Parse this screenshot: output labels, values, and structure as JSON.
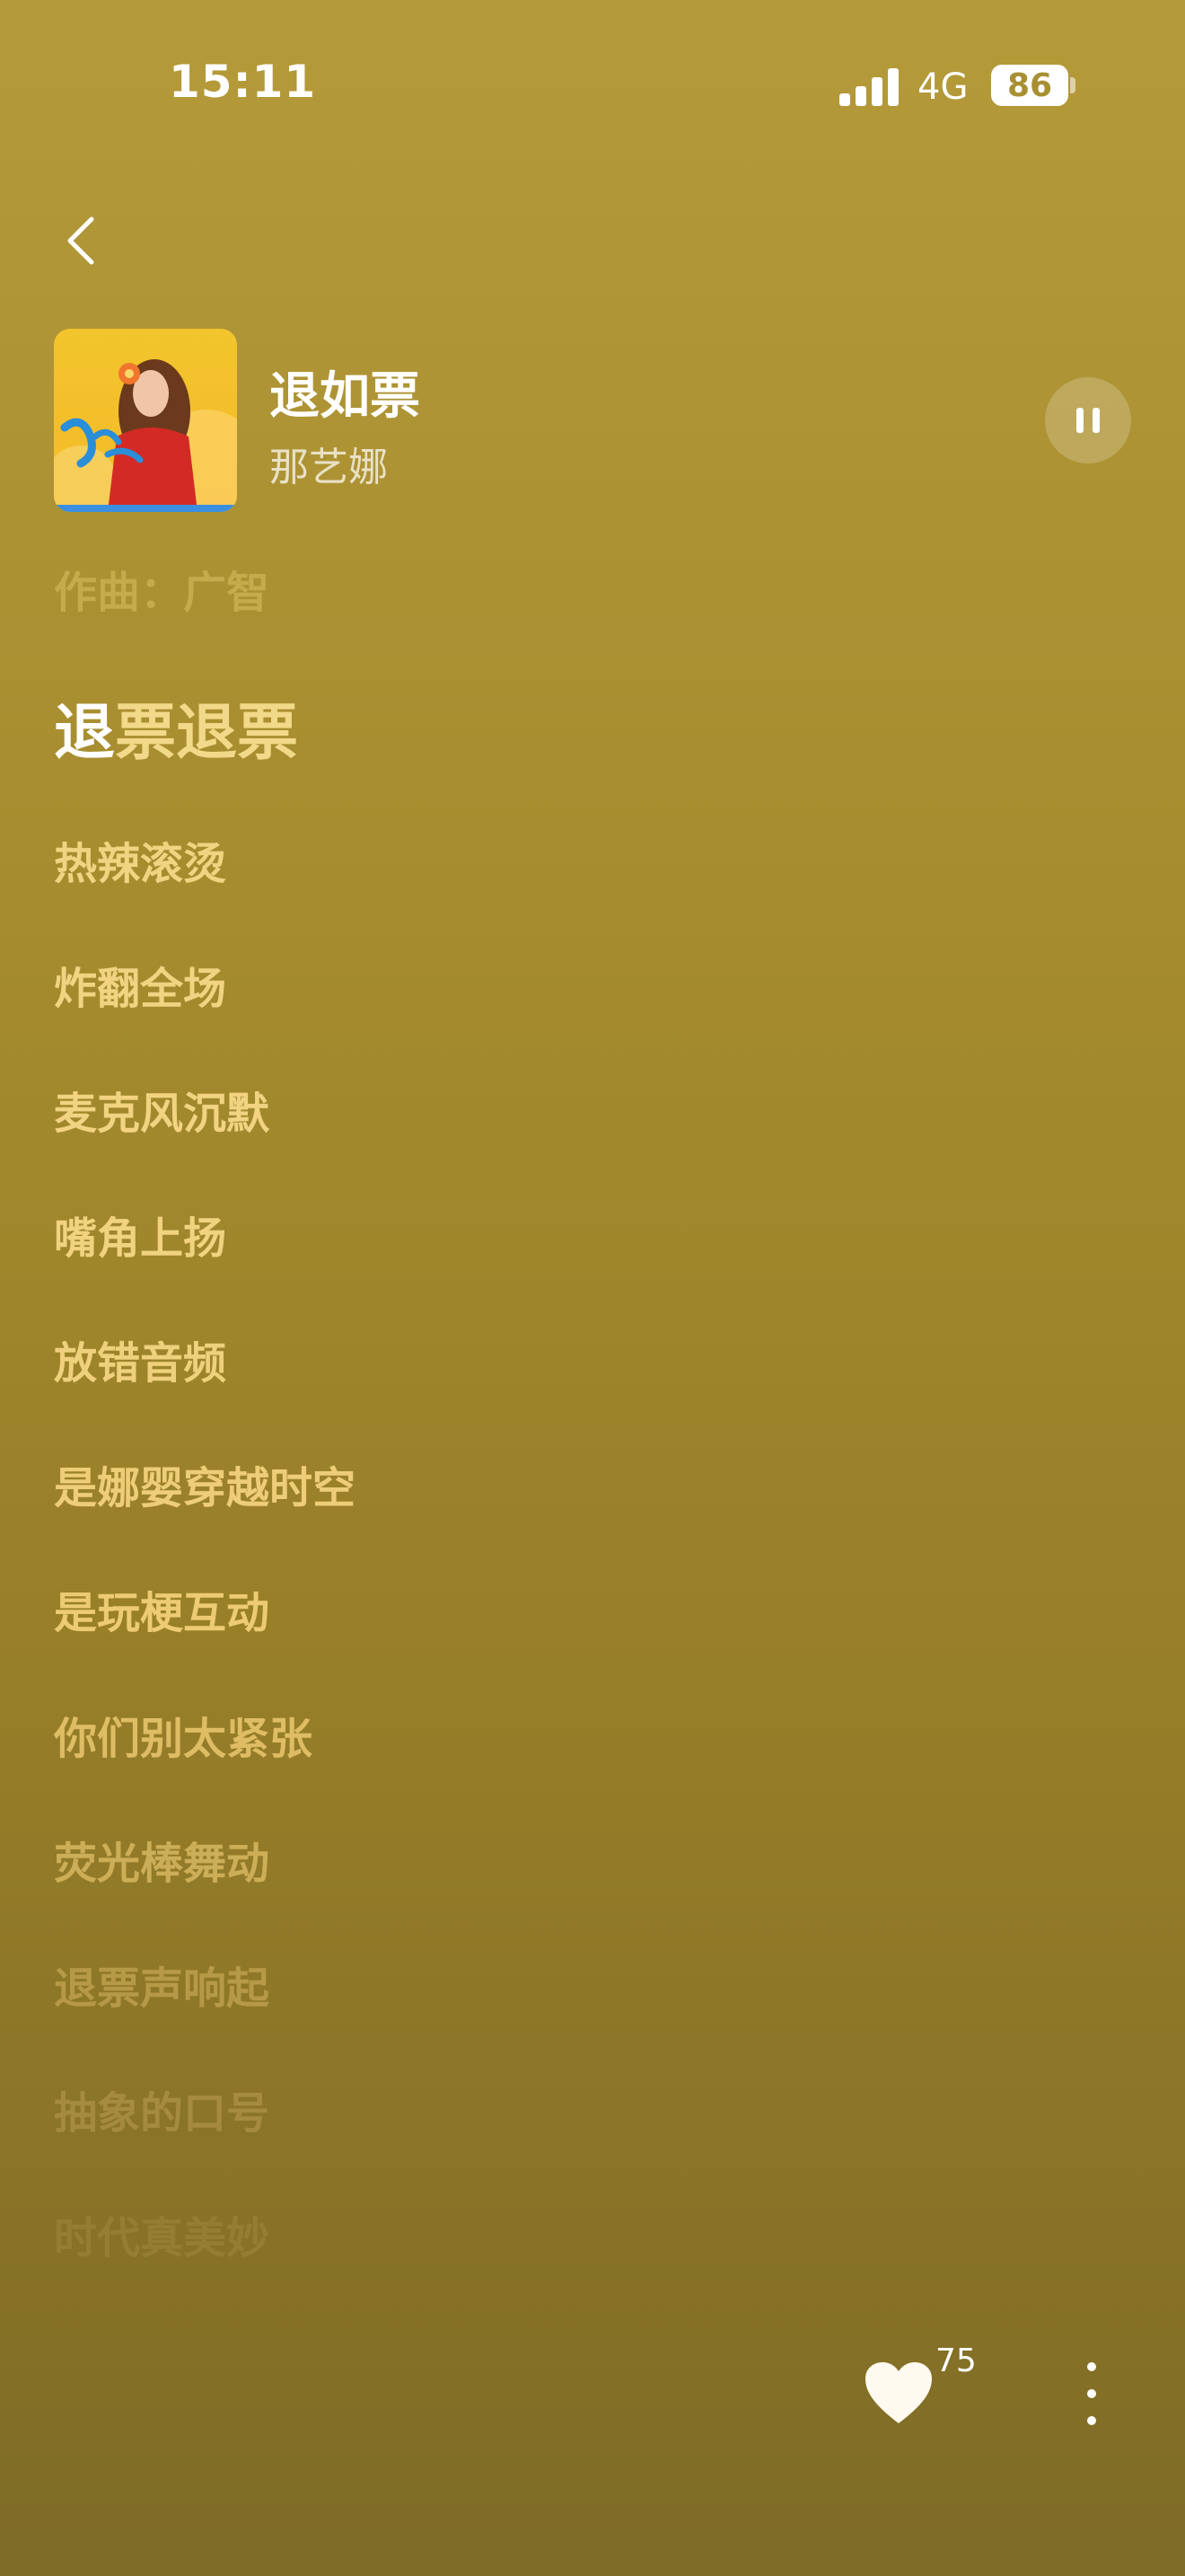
{
  "status_bar": {
    "time": "15:11",
    "network": "4G",
    "battery": "86"
  },
  "nav": {
    "back_icon": "chevron-left-icon"
  },
  "song": {
    "title": "退如票",
    "artist": "那艺娜",
    "state": "playing",
    "control_icon": "pause-icon"
  },
  "lyrics": {
    "credit": "作曲：广智",
    "current_line": {
      "sung": "退",
      "unsung": "票退票"
    },
    "upcoming": [
      "热辣滚烫",
      "炸翻全场",
      "麦克风沉默",
      "嘴角上扬",
      "放错音频",
      "是娜婴穿越时空",
      "是玩梗互动",
      "你们别太紧张",
      "荧光棒舞动",
      "退票声响起",
      "抽象的口号",
      "时代真美妙"
    ]
  },
  "actions": {
    "like_icon": "heart-icon",
    "like_count": "75",
    "more_icon": "more-vertical-icon"
  },
  "colors": {
    "background_top": "#b59a3a",
    "background_bottom": "#7e6b26",
    "lyric_highlight": "#ffffff",
    "lyric_upcoming": "#f1d382"
  }
}
